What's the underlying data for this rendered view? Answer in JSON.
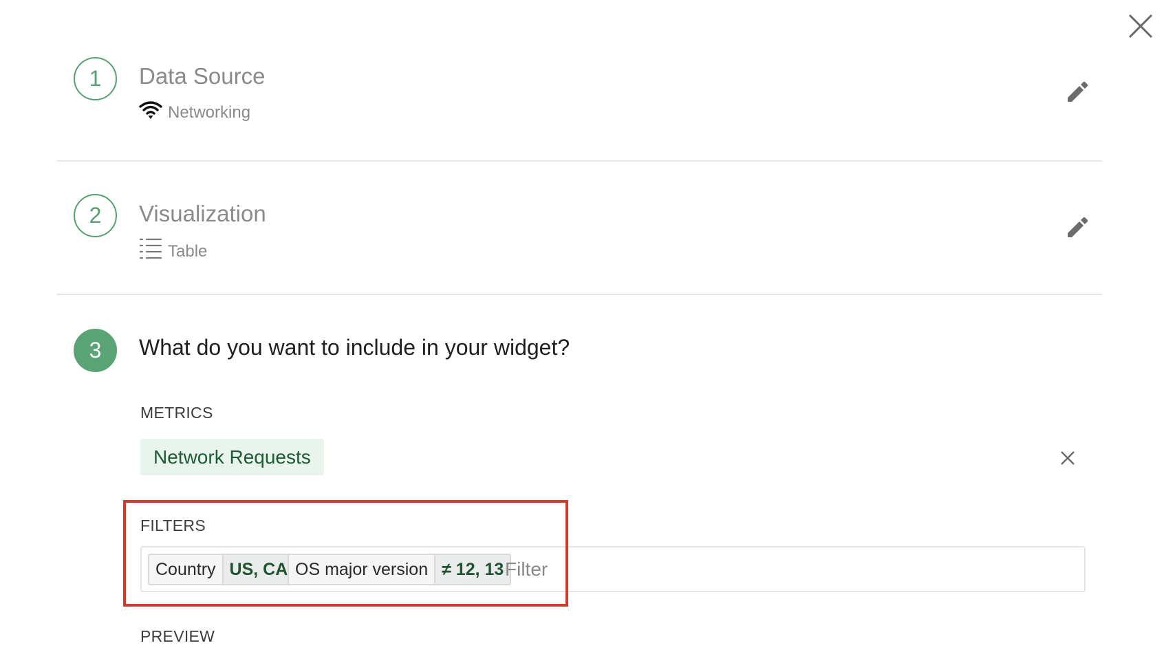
{
  "steps": [
    {
      "number": "1",
      "title": "Data Source",
      "subtitle": "Networking",
      "icon": "wifi-icon"
    },
    {
      "number": "2",
      "title": "Visualization",
      "subtitle": "Table",
      "icon": "list-icon"
    },
    {
      "number": "3",
      "title": "What do you want to include in your widget?"
    }
  ],
  "metrics": {
    "label": "METRICS",
    "selected": "Network Requests"
  },
  "filters": {
    "label": "FILTERS",
    "chips": [
      {
        "key": "Country",
        "value": "US, CA"
      },
      {
        "key": "OS major version",
        "value": "≠ 12, 13"
      }
    ],
    "input_placeholder": "Filter"
  },
  "preview": {
    "label": "PREVIEW"
  },
  "colors": {
    "accent": "#5aa375",
    "highlight": "#d0392b"
  }
}
